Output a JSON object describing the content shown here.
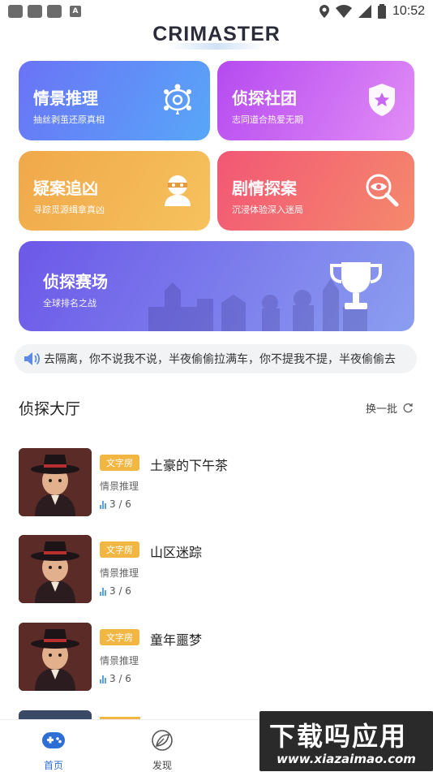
{
  "status": {
    "time": "10:52"
  },
  "app": {
    "logo": "CRIMASTER"
  },
  "cards": {
    "scene": {
      "title": "情景推理",
      "subtitle": "抽丝剥茧还原真相"
    },
    "club": {
      "title": "侦探社团",
      "subtitle": "志同道合热爱无期"
    },
    "suspect": {
      "title": "疑案追凶",
      "subtitle": "寻踪觅源缉拿真凶"
    },
    "plot": {
      "title": "剧情探案",
      "subtitle": "沉浸体验深入迷局"
    },
    "arena": {
      "title": "侦探赛场",
      "subtitle": "全球排名之战"
    }
  },
  "announcement": {
    "text": "去隔离，你不说我不说，半夜偷偷拉满车，你不提我不提，半夜偷偷去"
  },
  "hall": {
    "title": "侦探大厅",
    "refresh_label": "换一批",
    "rooms": [
      {
        "badge": "文字房",
        "name": "土豪的下午茶",
        "category": "情景推理",
        "count": "3 / 6"
      },
      {
        "badge": "文字房",
        "name": "山区迷踪",
        "category": "情景推理",
        "count": "3 / 6"
      },
      {
        "badge": "文字房",
        "name": "童年噩梦",
        "category": "情景推理",
        "count": "3 / 6"
      }
    ]
  },
  "tabs": {
    "home": "首页",
    "discover": "发现"
  },
  "watermark": {
    "line1": "下载吗应用",
    "line2": "www.xiazaimao.com"
  },
  "colors": {
    "accent": "#2e6fd6",
    "badge": "#f2b743"
  }
}
